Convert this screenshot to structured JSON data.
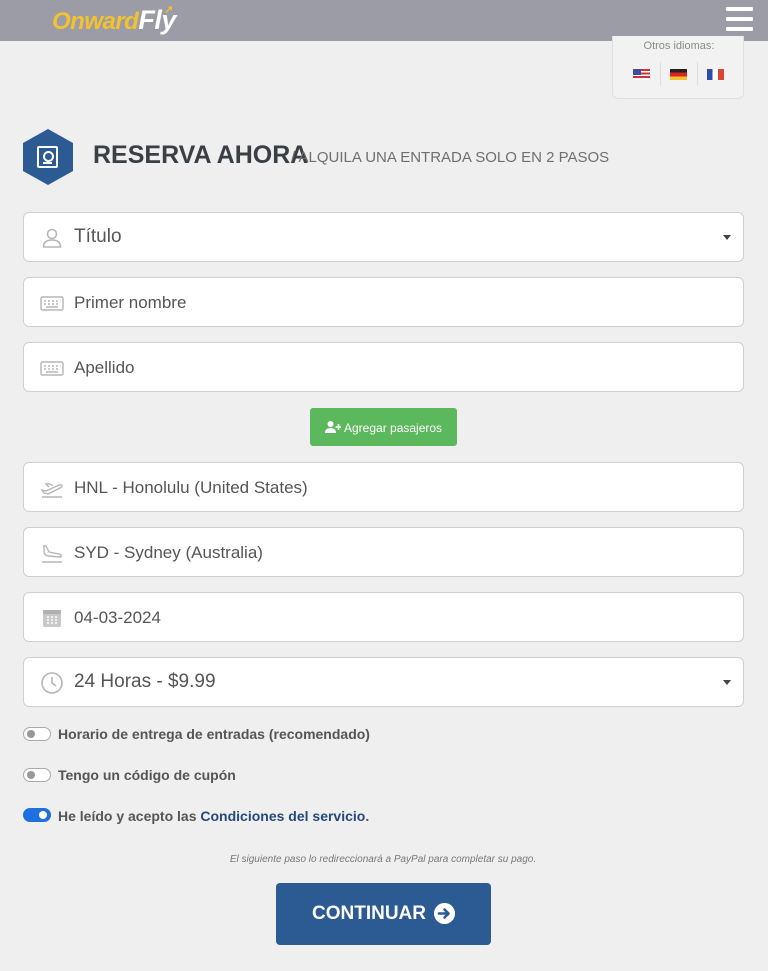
{
  "header": {
    "logo_onward": "Onward",
    "logo_fly": "Fly"
  },
  "languages": {
    "title": "Otros idiomas:",
    "flags": [
      "us-flag-icon",
      "de-flag-icon",
      "fr-flag-icon"
    ]
  },
  "heading": {
    "title": "RESERVA AHORA",
    "subtitle": "/ ALQUILA UNA ENTRADA SOLO EN 2 PASOS"
  },
  "form": {
    "title_select": "Título",
    "first_name_placeholder": "Primer nombre",
    "last_name_placeholder": "Apellido",
    "add_passengers": "Agregar pasajeros",
    "origin": "HNL - Honolulu (United States)",
    "destination": "SYD - Sydney (Australia)",
    "date": "04-03-2024",
    "plan": "24 Horas - $9.99"
  },
  "options": {
    "delivery_time": "Horario de entrega de entradas (recomendado)",
    "coupon": "Tengo un código de cupón",
    "terms_prefix": "He leído y acepto las",
    "terms_link": "Condiciones del servicio",
    "terms_suffix": "."
  },
  "note": "El siguiente paso lo redireccionará a PayPal para completar su pago.",
  "continue_label": "CONTINUAR",
  "colors": {
    "primary": "#2c5a92",
    "success": "#5cb85c",
    "topbar": "#9c9ca6",
    "logo": "#f2c230"
  }
}
